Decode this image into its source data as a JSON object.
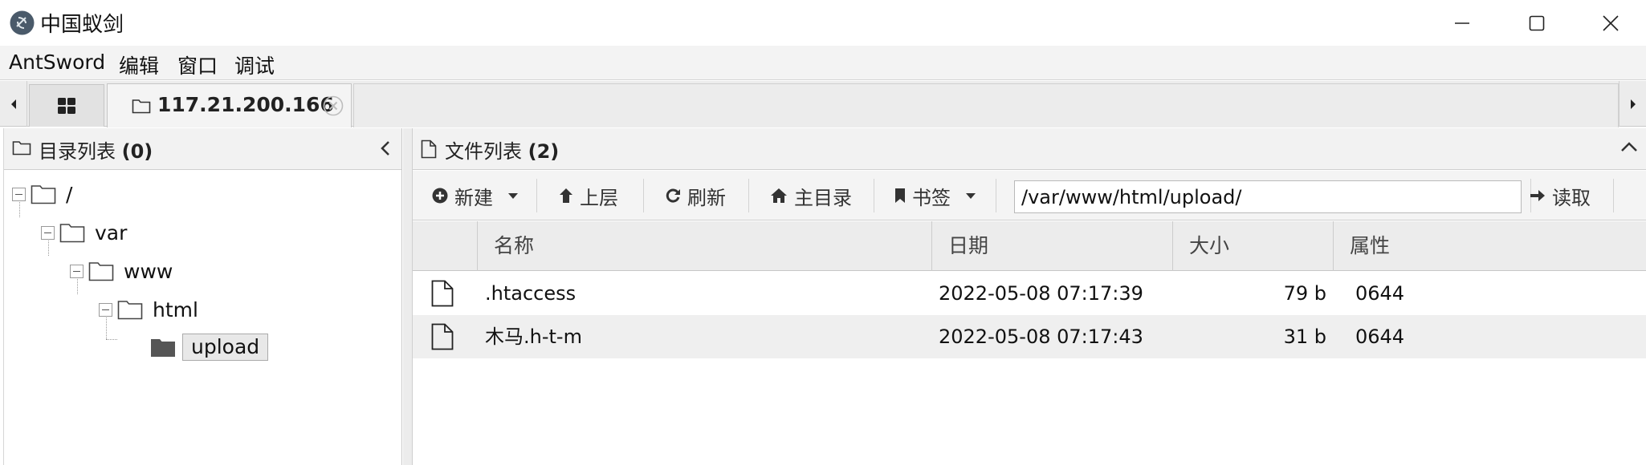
{
  "window": {
    "title": "中国蚁剑",
    "icons": {
      "logo": "antsword-logo",
      "minimize": "minimize-icon",
      "maximize": "maximize-icon",
      "close": "close-icon"
    }
  },
  "menu": {
    "items": [
      "AntSword",
      "编辑",
      "窗口",
      "调试"
    ]
  },
  "tabs": {
    "active_label": "117.21.200.166",
    "home_icon": "grid-icon"
  },
  "left_panel": {
    "title": "目录列表",
    "count": "(0)",
    "tree": [
      {
        "label": "/"
      },
      {
        "label": "var"
      },
      {
        "label": "www"
      },
      {
        "label": "html"
      },
      {
        "label": "upload"
      }
    ]
  },
  "right_panel": {
    "title": "文件列表",
    "count": "(2)",
    "toolbar": {
      "new": "新建",
      "up": "上层",
      "refresh": "刷新",
      "home": "主目录",
      "bookmark": "书签",
      "read": "读取"
    },
    "path": "/var/www/html/upload/",
    "columns": [
      "名称",
      "日期",
      "大小",
      "属性"
    ],
    "rows": [
      {
        "name": ".htaccess",
        "date": "2022-05-08 07:17:39",
        "size": "79 b",
        "perm": "0644"
      },
      {
        "name": "木马.h-t-m",
        "date": "2022-05-08 07:17:43",
        "size": "31 b",
        "perm": "0644"
      }
    ]
  },
  "colors": {
    "accent_folder_selected": "#555555",
    "titlebar_bg": "#ffffff",
    "menubar_bg": "#f3f3f3",
    "row_alt_bg": "#efefef"
  }
}
